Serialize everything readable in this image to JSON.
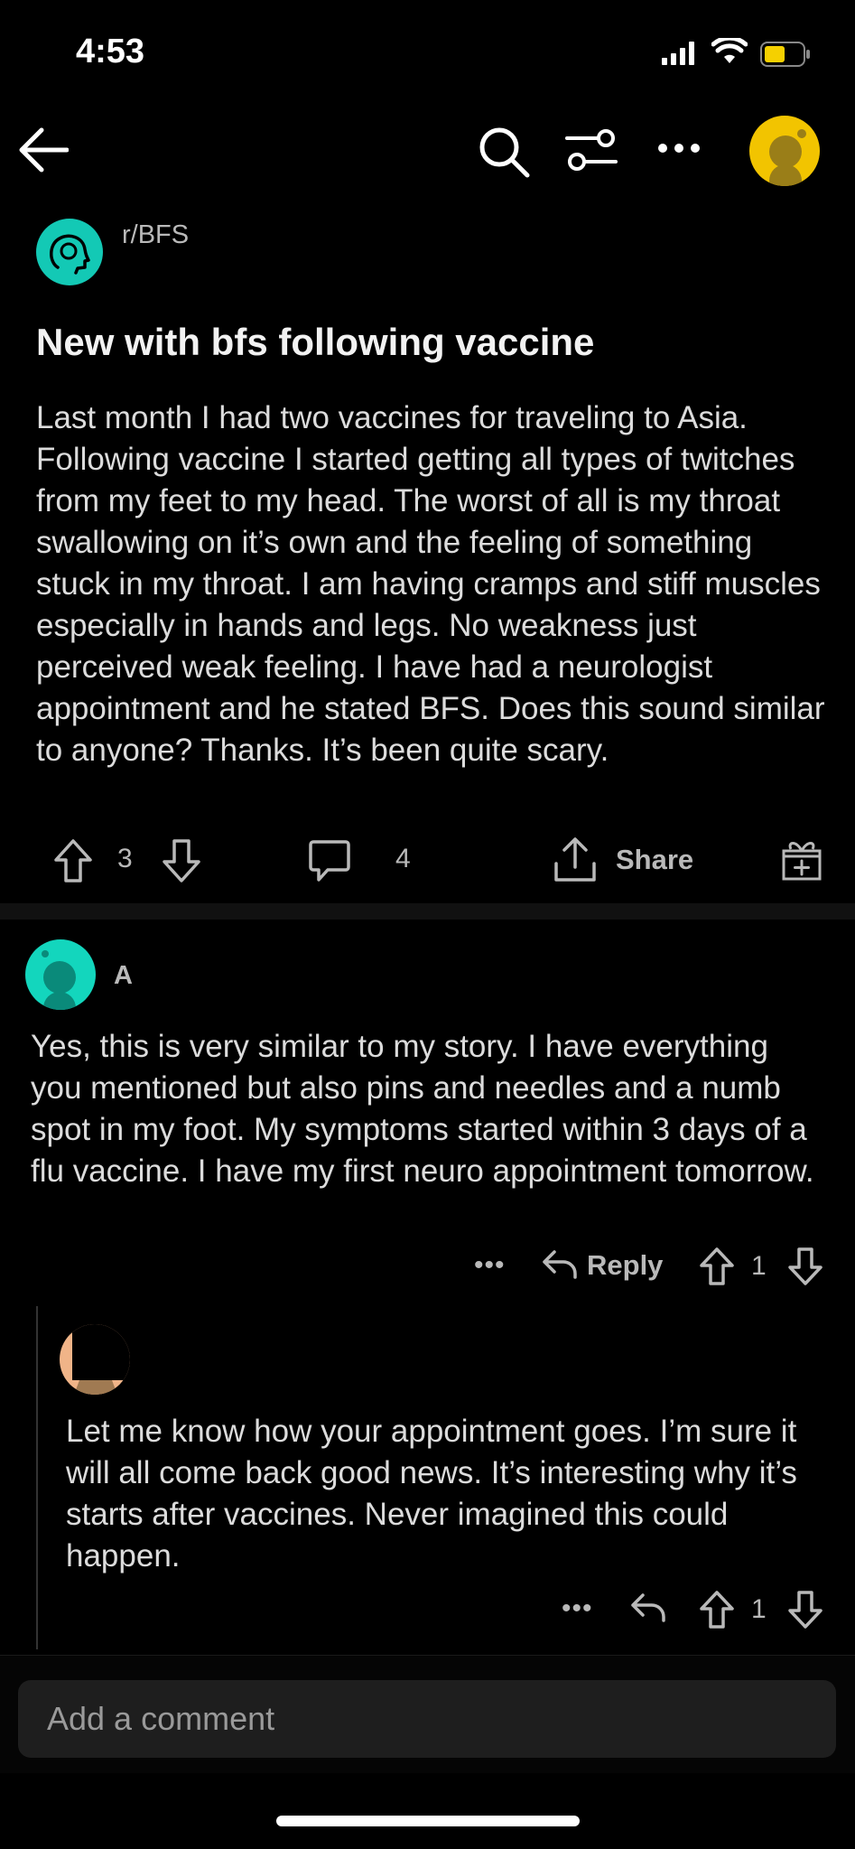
{
  "status_bar": {
    "time": "4:53"
  },
  "post": {
    "subreddit": "r/BFS",
    "title": "New with bfs following vaccine",
    "body": "Last month I had two vaccines for traveling to Asia. Following vaccine I started getting all types of twitches from my feet to my head. The worst of all is my throat swallowing on it’s own and the feeling of something stuck in my throat. I am having cramps and stiff muscles especially in hands and legs. No weakness just perceived weak feeling. I have had a neurologist appointment and he stated BFS. Does this sound similar to anyone? Thanks. It’s been quite scary.",
    "votes": "3",
    "comments": "4",
    "share_label": "Share"
  },
  "comments": [
    {
      "author": "A",
      "text": "Yes, this is very similar to my story. I have everything you mentioned but also pins and needles and a numb spot in my foot. My symptoms started within 3 days of a flu vaccine. I have my first neuro appointment tomorrow.",
      "more": "•••",
      "reply_label": "Reply",
      "score": "1"
    },
    {
      "text": "Let me know how your appointment goes. I’m sure it will all come back good news. It’s interesting why it’s starts after vaccines. Never imagined this could happen.",
      "more": "•••",
      "score": "1"
    }
  ],
  "composer": {
    "placeholder": "Add a comment"
  },
  "colors": {
    "background": "#000000",
    "subreddit_icon": "#13c9b5",
    "user_avatar": "#f2c400",
    "text": "#dcdcdc",
    "muted": "#b9b9b9"
  }
}
